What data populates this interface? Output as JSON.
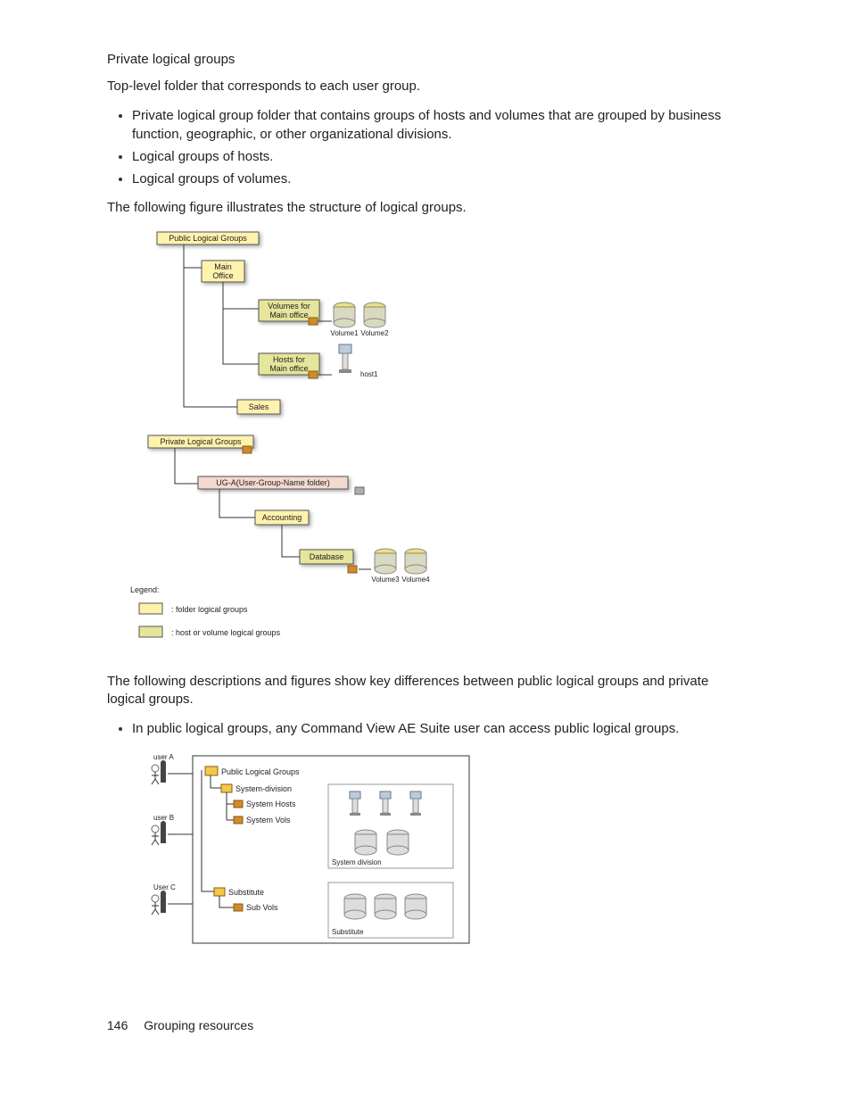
{
  "heading": "Private logical groups",
  "para_intro": "Top-level folder that corresponds to each user group.",
  "bullets1": [
    "Private logical group folder that contains groups of hosts and volumes that are grouped by business function, geographic, or other organizational divisions.",
    "Logical groups of hosts.",
    "Logical groups of volumes."
  ],
  "para_fig": "The following figure illustrates the structure of logical groups.",
  "diagram1": {
    "public_logical_groups": "Public Logical Groups",
    "main_office_l1": "Main",
    "main_office_l2": "Office",
    "volumes_for": "Volumes for",
    "main_office_sub": "Main office",
    "volume1": "Volume1",
    "volume2": "Volume2",
    "hosts_for": "Hosts for",
    "host1": "host1",
    "sales": "Sales",
    "private_logical_groups": "Private Logical Groups",
    "ug_a": "UG-A(User-Group-Name folder)",
    "accounting": "Accounting",
    "database": "Database",
    "volume3": "Volume3",
    "volume4": "Volume4",
    "legend_title": "Legend:",
    "legend_folder": ": folder logical groups",
    "legend_hostvol": ": host or volume logical groups"
  },
  "para_after_fig": "The following descriptions and figures show key differences between public logical groups and private logical groups.",
  "bullets2": [
    "In public logical groups, any Command View AE Suite user can access public logical groups."
  ],
  "diagram2": {
    "user_a": "user A",
    "user_b": "user B",
    "user_c": "User C",
    "pub": "Public Logical Groups",
    "sys_div": "System-division",
    "sys_hosts": "System Hosts",
    "sys_vols": "System Vols",
    "substitute": "Substitute",
    "sub_vols": "Sub Vols",
    "group1_label": "System division",
    "group2_label": "Substitute"
  },
  "footer_page": "146",
  "footer_title": "Grouping resources"
}
